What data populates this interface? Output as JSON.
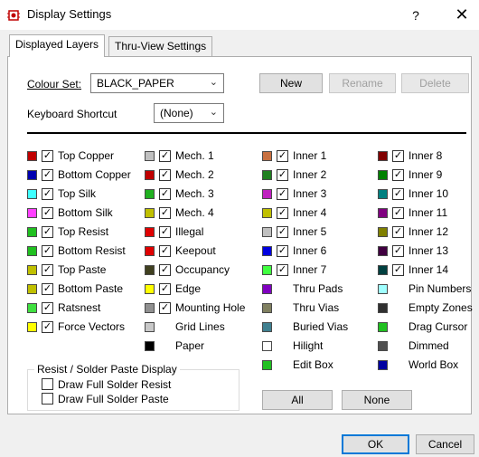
{
  "window": {
    "title": "Display Settings",
    "help": "?",
    "close": "✕"
  },
  "tabs": [
    {
      "label": "Displayed Layers",
      "active": true
    },
    {
      "label": "Thru-View Settings",
      "active": false
    }
  ],
  "colour_set": {
    "label": "Colour Set:",
    "value": "BLACK_PAPER",
    "new_button": "New",
    "rename_button": "Rename",
    "delete_button": "Delete"
  },
  "keyboard_shortcut": {
    "label": "Keyboard Shortcut",
    "value": "(None)"
  },
  "columns": [
    [
      {
        "label": "Top Copper",
        "color": "#c00000",
        "checked": true
      },
      {
        "label": "Bottom Copper",
        "color": "#0000b0",
        "checked": true
      },
      {
        "label": "Top Silk",
        "color": "#40ffff",
        "checked": true
      },
      {
        "label": "Bottom Silk",
        "color": "#ff40ff",
        "checked": true
      },
      {
        "label": "Top Resist",
        "color": "#20c020",
        "checked": true
      },
      {
        "label": "Bottom Resist",
        "color": "#20c020",
        "checked": true
      },
      {
        "label": "Top Paste",
        "color": "#c0c000",
        "checked": true
      },
      {
        "label": "Bottom Paste",
        "color": "#c0c000",
        "checked": true
      },
      {
        "label": "Ratsnest",
        "color": "#40e040",
        "checked": true
      },
      {
        "label": "Force Vectors",
        "color": "#ffff00",
        "checked": true
      }
    ],
    [
      {
        "label": "Mech. 1",
        "color": "#c0c0c0",
        "checked": true
      },
      {
        "label": "Mech. 2",
        "color": "#c00000",
        "checked": true
      },
      {
        "label": "Mech. 3",
        "color": "#20b020",
        "checked": true
      },
      {
        "label": "Mech. 4",
        "color": "#c0c000",
        "checked": true
      },
      {
        "label": "Illegal",
        "color": "#e00000",
        "checked": true
      },
      {
        "label": "Keepout",
        "color": "#e00000",
        "checked": true
      },
      {
        "label": "Occupancy",
        "color": "#404020",
        "checked": true
      },
      {
        "label": "Edge",
        "color": "#ffff00",
        "checked": true
      },
      {
        "label": "Mounting Hole",
        "color": "#909090",
        "checked": true
      },
      {
        "label": "Grid Lines",
        "color": "#c8c8c8",
        "checked": null
      },
      {
        "label": "Paper",
        "color": "#000000",
        "checked": null
      }
    ],
    [
      {
        "label": "Inner 1",
        "color": "#c87040",
        "checked": true
      },
      {
        "label": "Inner 2",
        "color": "#208020",
        "checked": true
      },
      {
        "label": "Inner 3",
        "color": "#c020c0",
        "checked": true
      },
      {
        "label": "Inner 4",
        "color": "#c0c000",
        "checked": true
      },
      {
        "label": "Inner 5",
        "color": "#c0c0c0",
        "checked": true
      },
      {
        "label": "Inner 6",
        "color": "#0000e0",
        "checked": true
      },
      {
        "label": "Inner 7",
        "color": "#40ff40",
        "checked": true
      },
      {
        "label": "Thru Pads",
        "color": "#8000c0",
        "checked": null
      },
      {
        "label": "Thru Vias",
        "color": "#808060",
        "checked": null
      },
      {
        "label": "Buried Vias",
        "color": "#408090",
        "checked": null
      },
      {
        "label": "Hilight",
        "color": "#ffffff",
        "checked": null
      },
      {
        "label": "Edit Box",
        "color": "#20c020",
        "checked": null
      }
    ],
    [
      {
        "label": "Inner 8",
        "color": "#800000",
        "checked": true
      },
      {
        "label": "Inner 9",
        "color": "#008000",
        "checked": true
      },
      {
        "label": "Inner 10",
        "color": "#008080",
        "checked": true
      },
      {
        "label": "Inner 11",
        "color": "#800080",
        "checked": true
      },
      {
        "label": "Inner 12",
        "color": "#808000",
        "checked": true
      },
      {
        "label": "Inner 13",
        "color": "#400040",
        "checked": true
      },
      {
        "label": "Inner 14",
        "color": "#004040",
        "checked": true
      },
      {
        "label": "Pin Numbers",
        "color": "#a0ffff",
        "checked": null
      },
      {
        "label": "Empty Zones",
        "color": "#303030",
        "checked": null
      },
      {
        "label": "Drag Cursor",
        "color": "#20c020",
        "checked": null
      },
      {
        "label": "Dimmed",
        "color": "#505050",
        "checked": null
      },
      {
        "label": "World Box",
        "color": "#0000a0",
        "checked": null
      }
    ]
  ],
  "resist_group": {
    "title": "Resist / Solder Paste Display",
    "option1": "Draw Full Solder Resist",
    "option2": "Draw Full Solder Paste"
  },
  "all_button": "All",
  "none_button": "None",
  "ok_button": "OK",
  "cancel_button": "Cancel"
}
